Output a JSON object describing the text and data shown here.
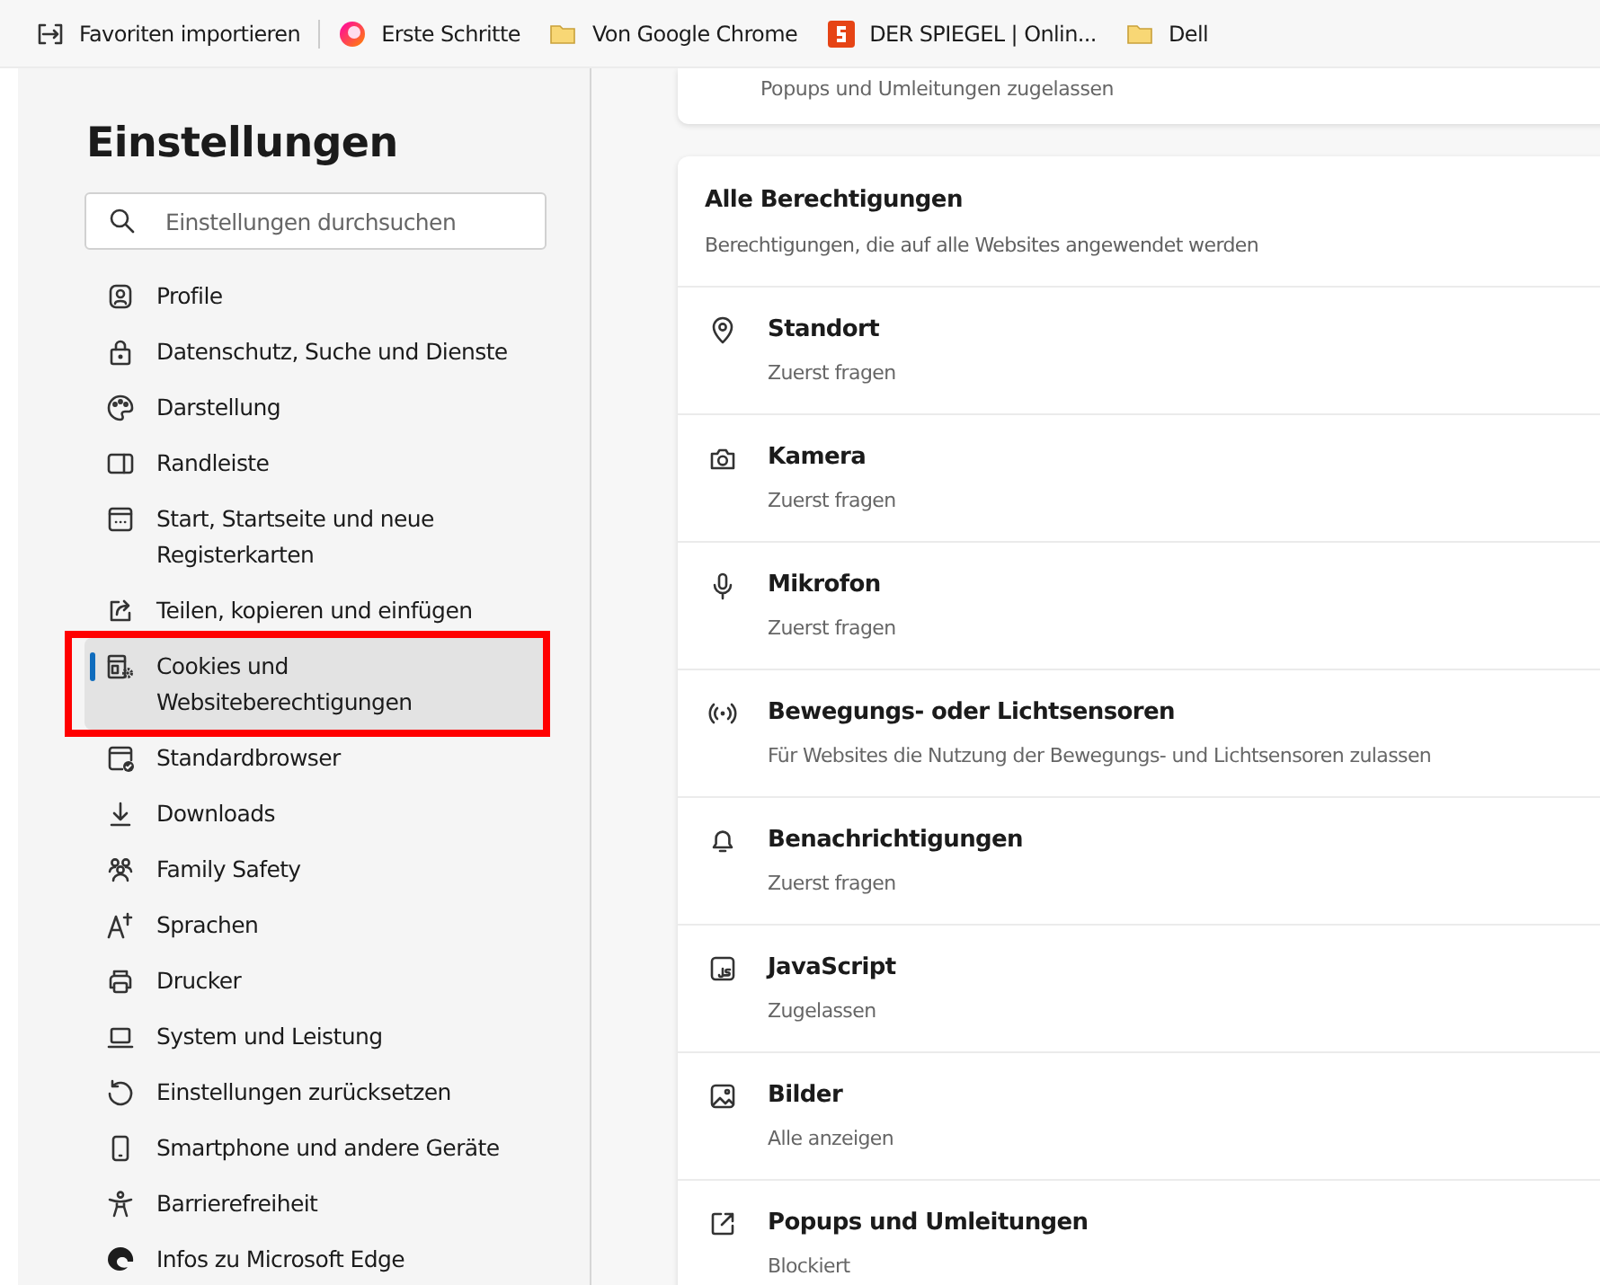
{
  "bookmarks_bar": {
    "items": [
      {
        "label": "Favoriten importieren",
        "kind": "import"
      },
      {
        "label": "Erste Schritte",
        "kind": "edge"
      },
      {
        "label": "Von Google Chrome",
        "kind": "folder"
      },
      {
        "label": "DER SPIEGEL | Onlin...",
        "kind": "spiegel"
      },
      {
        "label": "Dell",
        "kind": "folder"
      }
    ]
  },
  "sidebar": {
    "title": "Einstellungen",
    "search": {
      "placeholder": "Einstellungen durchsuchen"
    },
    "items": [
      {
        "label": "Profile",
        "kind": "profile",
        "selected": false,
        "highlighted": false
      },
      {
        "label": "Datenschutz, Suche und Dienste",
        "kind": "lock",
        "selected": false,
        "highlighted": false
      },
      {
        "label": "Darstellung",
        "kind": "palette",
        "selected": false,
        "highlighted": false
      },
      {
        "label": "Randleiste",
        "kind": "sidebar",
        "selected": false,
        "highlighted": false
      },
      {
        "label": "Start, Startseite und neue Registerkarten",
        "kind": "home",
        "selected": false,
        "highlighted": false
      },
      {
        "label": "Teilen, kopieren und einfügen",
        "kind": "share",
        "selected": false,
        "highlighted": false
      },
      {
        "label": "Cookies und Websiteberechtigungen",
        "kind": "cookies",
        "selected": true,
        "highlighted": true
      },
      {
        "label": "Standardbrowser",
        "kind": "browser",
        "selected": false,
        "highlighted": false
      },
      {
        "label": "Downloads",
        "kind": "download",
        "selected": false,
        "highlighted": false
      },
      {
        "label": "Family Safety",
        "kind": "family",
        "selected": false,
        "highlighted": false
      },
      {
        "label": "Sprachen",
        "kind": "language",
        "selected": false,
        "highlighted": false
      },
      {
        "label": "Drucker",
        "kind": "printer",
        "selected": false,
        "highlighted": false
      },
      {
        "label": "System und Leistung",
        "kind": "laptop",
        "selected": false,
        "highlighted": false
      },
      {
        "label": "Einstellungen zurücksetzen",
        "kind": "reset",
        "selected": false,
        "highlighted": false
      },
      {
        "label": "Smartphone und andere Geräte",
        "kind": "phone",
        "selected": false,
        "highlighted": false
      },
      {
        "label": "Barrierefreiheit",
        "kind": "accessibility",
        "selected": false,
        "highlighted": false
      },
      {
        "label": "Infos zu Microsoft Edge",
        "kind": "edge",
        "selected": false,
        "highlighted": false
      }
    ]
  },
  "previous_card": {
    "text": "Popups und Umleitungen zugelassen"
  },
  "permissions": {
    "title": "Alle Berechtigungen",
    "subtitle": "Berechtigungen, die auf alle Websites angewendet werden",
    "rows": [
      {
        "title": "Standort",
        "status": "Zuerst fragen",
        "kind": "location"
      },
      {
        "title": "Kamera",
        "status": "Zuerst fragen",
        "kind": "camera"
      },
      {
        "title": "Mikrofon",
        "status": "Zuerst fragen",
        "kind": "mic"
      },
      {
        "title": "Bewegungs- oder Lichtsensoren",
        "status": "Für Websites die Nutzung der Bewegungs- und Lichtsensoren zulassen",
        "kind": "sensor"
      },
      {
        "title": "Benachrichtigungen",
        "status": "Zuerst fragen",
        "kind": "bell"
      },
      {
        "title": "JavaScript",
        "status": "Zugelassen",
        "kind": "script"
      },
      {
        "title": "Bilder",
        "status": "Alle anzeigen",
        "kind": "image"
      },
      {
        "title": "Popups und Umleitungen",
        "status": "Blockiert",
        "kind": "popup"
      }
    ]
  }
}
